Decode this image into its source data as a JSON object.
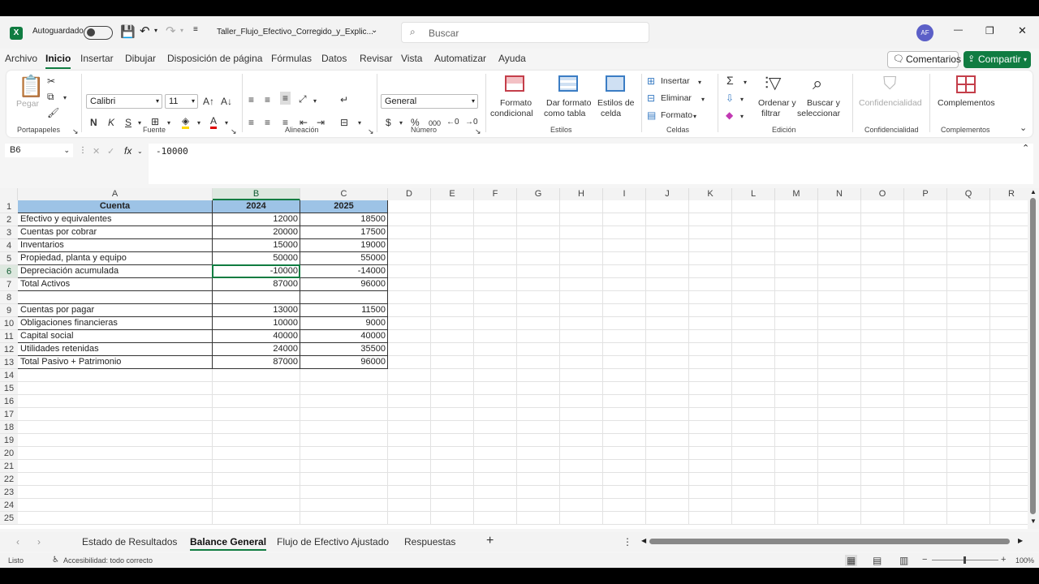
{
  "app": {
    "logo": "X",
    "autosave_label": "Autoguardado",
    "file_name": "Taller_Flujo_Efectivo_Corregido_y_Explic...",
    "user_initials": "AF"
  },
  "search": {
    "placeholder": "Buscar"
  },
  "window": {
    "minimize": "—",
    "restore": "❐",
    "close": "✕"
  },
  "menu": [
    "Archivo",
    "Inicio",
    "Insertar",
    "Dibujar",
    "Disposición de página",
    "Fórmulas",
    "Datos",
    "Revisar",
    "Vista",
    "Automatizar",
    "Ayuda"
  ],
  "actions": {
    "comments": "Comentarios",
    "share": "Compartir"
  },
  "ribbon": {
    "portapapeles": {
      "label": "Portapapeles",
      "paste": "Pegar"
    },
    "fuente": {
      "label": "Fuente",
      "font": "Calibri",
      "size": "11",
      "bold": "N",
      "italic": "K",
      "underline": "S"
    },
    "alineacion": {
      "label": "Alineación"
    },
    "numero": {
      "label": "Número",
      "format": "General",
      "thousands": "000"
    },
    "estilos": {
      "label": "Estilos",
      "cond_1": "Formato",
      "cond_2": "condicional",
      "table_1": "Dar formato",
      "table_2": "como tabla",
      "cell_1": "Estilos de",
      "cell_2": "celda"
    },
    "celdas": {
      "label": "Celdas",
      "insert": "Insertar",
      "delete": "Eliminar",
      "format": "Formato"
    },
    "edicion": {
      "label": "Edición",
      "sort_1": "Ordenar y",
      "sort_2": "filtrar",
      "find_1": "Buscar y",
      "find_2": "seleccionar"
    },
    "confidencialidad": {
      "label": "Confidencialidad",
      "button": "Confidencialidad"
    },
    "complementos": {
      "label": "Complementos",
      "button": "Complementos"
    }
  },
  "formula": {
    "cell_ref": "B6",
    "fx": "fx",
    "value": "-10000"
  },
  "columns": [
    "A",
    "B",
    "C",
    "D",
    "E",
    "F",
    "G",
    "H",
    "I",
    "J",
    "K",
    "L",
    "M",
    "N",
    "O",
    "P",
    "Q",
    "R"
  ],
  "rows": [
    "1",
    "2",
    "3",
    "4",
    "5",
    "6",
    "7",
    "8",
    "9",
    "10",
    "11",
    "12",
    "13",
    "14",
    "15",
    "16",
    "17",
    "18",
    "19",
    "20",
    "21",
    "22",
    "23",
    "24",
    "25"
  ],
  "table": {
    "header": [
      "Cuenta",
      "2024",
      "2025"
    ],
    "rows": [
      [
        "Efectivo y equivalentes",
        "12000",
        "18500"
      ],
      [
        "Cuentas por cobrar",
        "20000",
        "17500"
      ],
      [
        "Inventarios",
        "15000",
        "19000"
      ],
      [
        "Propiedad, planta y equipo",
        "50000",
        "55000"
      ],
      [
        "Depreciación acumulada",
        "-10000",
        "-14000"
      ],
      [
        "Total Activos",
        "87000",
        "96000"
      ],
      [
        "",
        "",
        ""
      ],
      [
        "Cuentas por pagar",
        "13000",
        "11500"
      ],
      [
        "Obligaciones financieras",
        "10000",
        "9000"
      ],
      [
        "Capital social",
        "40000",
        "40000"
      ],
      [
        "Utilidades retenidas",
        "24000",
        "35500"
      ],
      [
        "Total Pasivo + Patrimonio",
        "87000",
        "96000"
      ]
    ]
  },
  "sheets": [
    "Estado de Resultados",
    "Balance General",
    "Flujo de Efectivo Ajustado",
    "Respuestas"
  ],
  "status": {
    "ready": "Listo",
    "accessibility": "Accesibilidad: todo correcto",
    "zoom": "100%"
  },
  "colors": {
    "accent": "#107c41",
    "header_fill": "#9dc3e6"
  }
}
